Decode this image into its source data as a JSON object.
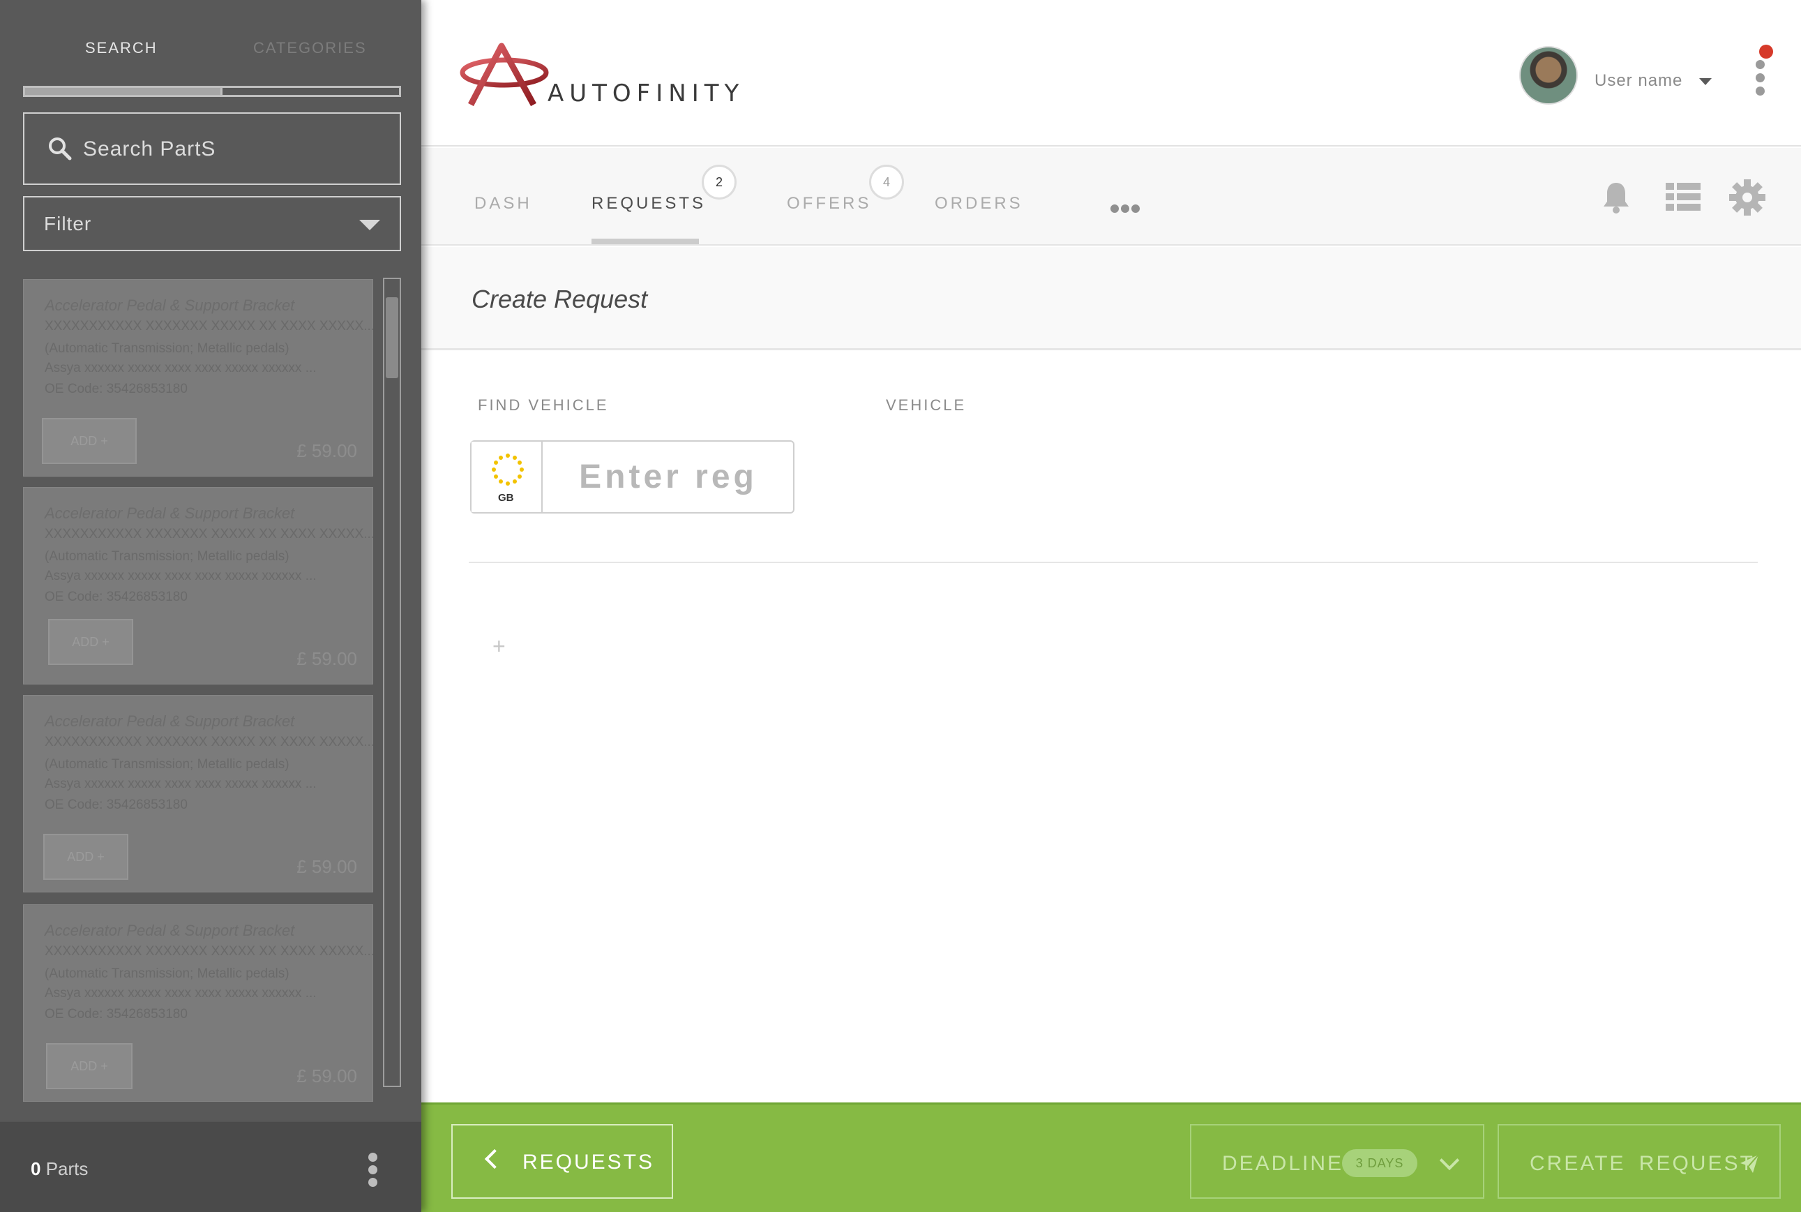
{
  "sidebar": {
    "tabs": [
      {
        "label": "SEARCH",
        "active": true
      },
      {
        "label": "CATEGORIES",
        "active": false
      }
    ],
    "search": {
      "placeholder": "Search PartS",
      "icon": "search-icon"
    },
    "filter": {
      "label": "Filter",
      "icon": "chevron-down-icon"
    },
    "parts": [
      {
        "title": "Accelerator Pedal & Support Bracket",
        "line1": "XXXXXXXXXXX XXXXXXX XXXXX XX XXXX XXXXX...",
        "line2": "(Automatic Transmission; Metallic pedals)",
        "line3": "Assya xxxxxx xxxxx xxxx xxxx xxxxx xxxxxx ...",
        "oe": "OE Code: 35426853180",
        "button": "ADD +",
        "price": "£ 59.00"
      },
      {
        "title": "Accelerator Pedal & Support Bracket",
        "line1": "XXXXXXXXXXX XXXXXXX XXXXX XX XXXX XXXXX...",
        "line2": "(Automatic Transmission; Metallic pedals)",
        "line3": "Assya xxxxxx xxxxx xxxx xxxx xxxxx xxxxxx ...",
        "oe": "OE Code: 35426853180",
        "button": "ADD +",
        "price": "£ 59.00"
      },
      {
        "title": "Accelerator Pedal & Support Bracket",
        "line1": "XXXXXXXXXXX XXXXXXX XXXXX XX XXXX XXXXX...",
        "line2": "(Automatic Transmission; Metallic pedals)",
        "line3": "Assya xxxxxx xxxxx xxxx xxxx xxxxx xxxxxx ...",
        "oe": "OE Code: 35426853180",
        "button": "ADD +",
        "price": "£ 59.00"
      },
      {
        "title": "Accelerator Pedal & Support Bracket",
        "line1": "XXXXXXXXXXX XXXXXXX XXXXX XX XXXX XXXXX...",
        "line2": "(Automatic Transmission; Metallic pedals)",
        "line3": "Assya xxxxxx xxxxx xxxx xxxx xxxxx xxxxxx ...",
        "oe": "OE Code: 35426853180",
        "button": "ADD +",
        "price": "£ 59.00"
      }
    ],
    "footer": {
      "count": "0",
      "count_label": " Parts"
    }
  },
  "header": {
    "logo_text": "AUTOFINITY",
    "username": "User name"
  },
  "nav": {
    "tabs": [
      {
        "label": "DASH",
        "active": false
      },
      {
        "label": "REQUESTS",
        "active": true,
        "badge": "2"
      },
      {
        "label": "OFFERS",
        "active": false,
        "badge": "4"
      },
      {
        "label": "ORDERS",
        "active": false
      }
    ],
    "icons": [
      "more-icon",
      "bell-icon",
      "list-icon",
      "gear-icon"
    ]
  },
  "content": {
    "title": "Create Request",
    "find_vehicle_label": "FIND VEHICLE",
    "vehicle_label": "VEHICLE",
    "reg": {
      "country": "GB",
      "placeholder": "Enter reg"
    },
    "add_symbol": "+"
  },
  "footer": {
    "back_label": "REQUESTS",
    "deadline_label": "DEADLINE",
    "deadline_value": "3 DAYS",
    "create_label": "CREATE REQUEST"
  },
  "colors": {
    "sidebar_bg": "#595959",
    "accent_green": "#86ba44",
    "notification_red": "#d63a2a",
    "logo_red": "#b8262b"
  }
}
